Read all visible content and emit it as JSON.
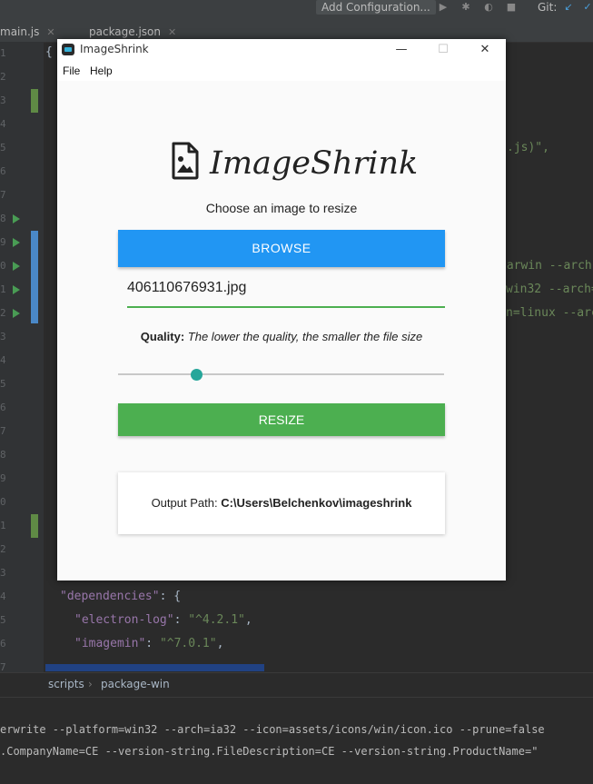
{
  "ide": {
    "toolbar": {
      "config_label": "Add Configuration...",
      "git_label": "Git:"
    },
    "tabs": [
      {
        "label": "main.js"
      },
      {
        "label": "package.json"
      }
    ],
    "line_numbers": [
      "1",
      "2",
      "3",
      "4",
      "5",
      "6",
      "7",
      "8",
      "9",
      "0",
      "1",
      "2",
      "3",
      "4",
      "5",
      "6",
      "7",
      "8",
      "9",
      "0",
      "1",
      "2",
      "3",
      "4",
      "5",
      "6",
      "7"
    ],
    "code": {
      "brace": "{",
      "frag_main": ".js)\",",
      "frag_darwin": "darwin --arch",
      "frag_win": "win32 --arch=",
      "frag_linux": "n=linux --arc",
      "dep_key": "\"dependencies\"",
      "dep_punc": ": {",
      "electron_log_key": "\"electron-log\"",
      "electron_log_val": "\"^4.2.1\"",
      "imagemin_key": "\"imagemin\"",
      "imagemin_val": "\"^7.0.1\"",
      "sep_colon": ": ",
      "sep_comma": ","
    },
    "breadcrumbs": {
      "scripts": "scripts",
      "separator": "›",
      "package_win": "package-win"
    },
    "terminal": [
      "erwrite --platform=win32 --arch=ia32 --icon=assets/icons/win/icon.ico --prune=false",
      ".CompanyName=CE --version-string.FileDescription=CE --version-string.ProductName=\""
    ]
  },
  "app": {
    "window_title": "ImageShrink",
    "controls": {
      "minimize": "—",
      "maximize": "☐",
      "close": "✕"
    },
    "menu": {
      "file": "File",
      "help": "Help"
    },
    "logo_text": "ImageShrink",
    "subtitle": "Choose an image to resize",
    "browse_label": "BROWSE",
    "file_name": "406110676931.jpg",
    "quality_label": "Quality:",
    "quality_hint": "The lower the quality, the smaller the file size",
    "quality_value": 0.24,
    "resize_label": "RESIZE",
    "output_label": "Output Path:",
    "output_path": "C:\\Users\\Belchenkov\\imageshrink",
    "colors": {
      "browse": "#2196f3",
      "resize": "#4caf50",
      "slider_thumb": "#26a69a"
    }
  }
}
